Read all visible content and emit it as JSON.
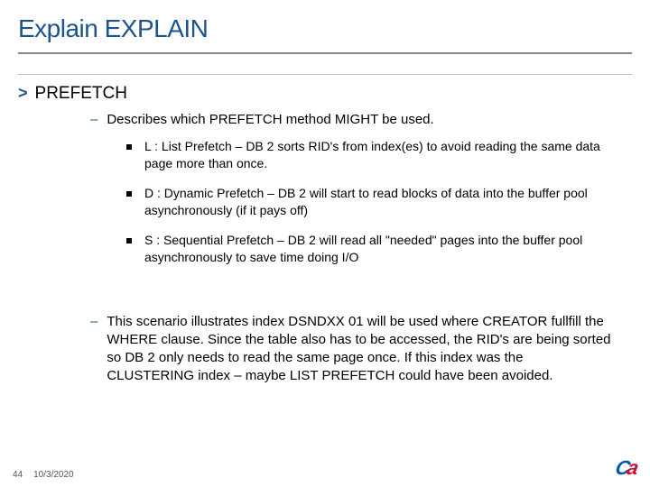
{
  "title": "Explain EXPLAIN",
  "section": "PREFETCH",
  "intro": "Describes which PREFETCH method MIGHT be used.",
  "items": [
    {
      "text": "L :  List Prefetch – DB 2 sorts RID's from index(es) to avoid reading the same data page more than once."
    },
    {
      "text": "D :  Dynamic Prefetch – DB 2 will start to read blocks of data into the buffer pool asynchronously (if it pays off)"
    },
    {
      "text": "S :  Sequential Prefetch – DB 2 will read all \"needed\" pages into the buffer pool asynchronously to save time doing I/O"
    }
  ],
  "scenario": "This scenario illustrates index DSNDXX 01 will be used where CREATOR fullfill the WHERE clause. Since the table also has to be accessed, the RID's are being sorted so DB 2 only needs to read the same page once. If this index was the CLUSTERING index – maybe LIST PREFETCH could have been avoided.",
  "footer": {
    "page": "44",
    "date": "10/3/2020"
  },
  "logo": {
    "c": "C",
    "a": "a"
  }
}
